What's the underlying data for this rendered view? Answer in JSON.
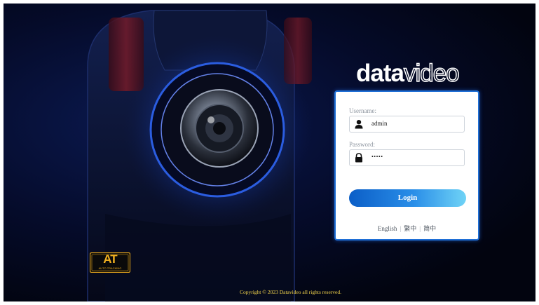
{
  "brand": {
    "logo_bold": "data",
    "logo_thin": "video"
  },
  "badge": {
    "label": "AT",
    "sublabel": "AUTO TRACKING"
  },
  "login": {
    "username_label": "Username:",
    "username_value": "admin",
    "password_label": "Password:",
    "password_value": "•••••",
    "login_button": "Login"
  },
  "languages": {
    "english": "English",
    "separator": "|",
    "traditional_chinese": "繁中",
    "simplified_chinese": "简中"
  },
  "footer": {
    "copyright": "Copyright © 2023 Datavideo all rights reserved."
  },
  "colors": {
    "accent": "#1f6fd6",
    "button_start": "#0b5ec7",
    "button_end": "#6fd3f6",
    "copyright_text": "#f2d44c",
    "background": "#050b2a"
  },
  "icons": {
    "username": "user-icon",
    "password": "lock-icon"
  }
}
